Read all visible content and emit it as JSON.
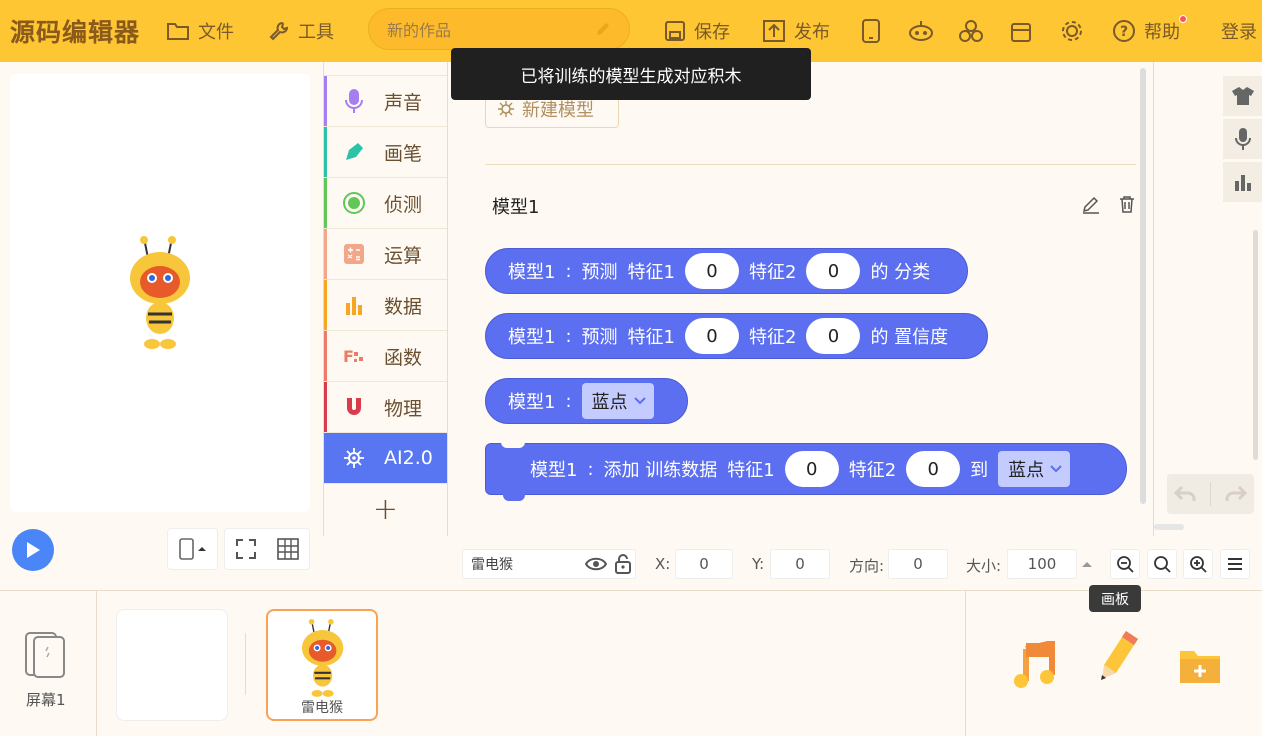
{
  "app": {
    "logo": "源码编辑器",
    "menu": {
      "file": "文件",
      "tools": "工具"
    },
    "title_placeholder": "新的作品",
    "save": "保存",
    "publish": "发布",
    "help": "帮助",
    "login": "登录"
  },
  "toast": "已将训练的模型生成对应积木",
  "categories": [
    {
      "label": "声音",
      "color": "#a77df2"
    },
    {
      "label": "画笔",
      "color": "#2bc3a8"
    },
    {
      "label": "侦测",
      "color": "#62c659"
    },
    {
      "label": "运算",
      "color": "#f2a68a"
    },
    {
      "label": "数据",
      "color": "#f6a623"
    },
    {
      "label": "函数",
      "color": "#ea7c68"
    },
    {
      "label": "物理",
      "color": "#d93b4c"
    },
    {
      "label": "AI2.0",
      "color": "#5876f2"
    }
  ],
  "workspace": {
    "new_model": "新建模型",
    "model_title": "模型1",
    "blocks": {
      "b1": {
        "model": "模型1",
        "sep": ":",
        "verb": "预测",
        "f1": "特征1",
        "v1": "0",
        "f2": "特征2",
        "v2": "0",
        "tail": "的 分类"
      },
      "b2": {
        "model": "模型1",
        "sep": ":",
        "verb": "预测",
        "f1": "特征1",
        "v1": "0",
        "f2": "特征2",
        "v2": "0",
        "tail": "的 置信度"
      },
      "b3": {
        "model": "模型1",
        "sep": ":",
        "option": "蓝点"
      },
      "b4": {
        "model": "模型1",
        "sep": ":",
        "verb": "添加 训练数据",
        "f1": "特征1",
        "v1": "0",
        "f2": "特征2",
        "v2": "0",
        "to": "到",
        "option": "蓝点"
      }
    }
  },
  "props": {
    "sprite_name": "雷电猴",
    "x_label": "X:",
    "x": "0",
    "y_label": "Y:",
    "y": "0",
    "dir_label": "方向:",
    "dir": "0",
    "size_label": "大小:",
    "size": "100"
  },
  "tooltip": "画板",
  "bottom": {
    "screen_label": "屏幕1",
    "sprite_label": "雷电猴"
  }
}
